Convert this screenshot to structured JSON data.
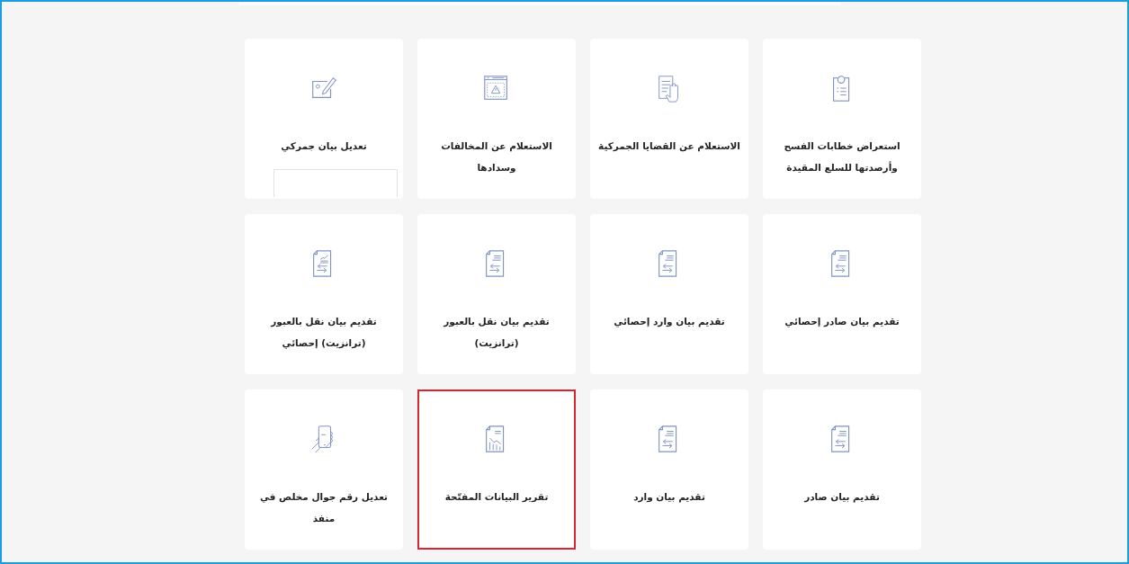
{
  "services": [
    {
      "label": "استعراض خطابات الفسح وأرصدتها للسلع المقيدة",
      "kind": "badge",
      "selected": false,
      "panel": false
    },
    {
      "label": "الاستعلام عن القضايا الجمركية",
      "kind": "hand",
      "selected": false,
      "panel": false
    },
    {
      "label": "الاستعلام عن المخالفات وسدادها",
      "kind": "warning",
      "selected": false,
      "panel": false
    },
    {
      "label": "تعديل بيان جمركي",
      "kind": "pen",
      "selected": false,
      "panel": true
    },
    {
      "label": "تقديم بيان صادر إحصائي",
      "kind": "arrows",
      "selected": false,
      "panel": false
    },
    {
      "label": "تقديم بيان وارد إحصائي",
      "kind": "arrows",
      "selected": false,
      "panel": false
    },
    {
      "label": "تقديم بيان نقل بالعبور (ترانزيت)",
      "kind": "arrows",
      "selected": false,
      "panel": false
    },
    {
      "label": "تقديم بيان نقل بالعبور (ترانزيت) إحصائي",
      "kind": "trend",
      "selected": false,
      "panel": false
    },
    {
      "label": "تقديم بيان صادر",
      "kind": "arrows",
      "selected": false,
      "panel": false
    },
    {
      "label": "تقديم بيان وارد",
      "kind": "arrows",
      "selected": false,
      "panel": false
    },
    {
      "label": "تقرير البيانات المفتّحة",
      "kind": "chart",
      "selected": true,
      "panel": false
    },
    {
      "label": "تعديل رقم جوال مخلص في منفذ",
      "kind": "phone",
      "selected": false,
      "panel": false
    }
  ]
}
